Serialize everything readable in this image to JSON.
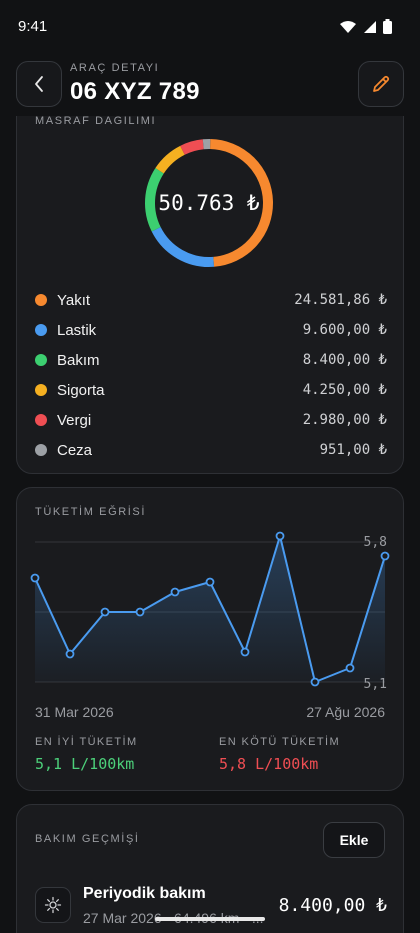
{
  "status_bar": {
    "time": "9:41"
  },
  "header": {
    "subtitle": "ARAÇ DETAYI",
    "title": "06 XYZ 789"
  },
  "expense": {
    "section_label": "MASRAF DAĞILIMI",
    "total": "50.763 ₺",
    "items": [
      {
        "name": "Yakıt",
        "value": "24.581,86 ₺",
        "amount": 24581.86,
        "color": "#f7892f"
      },
      {
        "name": "Lastik",
        "value": "9.600,00 ₺",
        "amount": 9600.0,
        "color": "#4a9bf0"
      },
      {
        "name": "Bakım",
        "value": "8.400,00 ₺",
        "amount": 8400.0,
        "color": "#3ccf70"
      },
      {
        "name": "Sigorta",
        "value": "4.250,00 ₺",
        "amount": 4250.0,
        "color": "#f5b021"
      },
      {
        "name": "Vergi",
        "value": "2.980,00 ₺",
        "amount": 2980.0,
        "color": "#ef4e53"
      },
      {
        "name": "Ceza",
        "value": "951,00 ₺",
        "amount": 951.0,
        "color": "#9da1a6"
      }
    ]
  },
  "consumption": {
    "section_label": "TÜKETİM EĞRİSİ",
    "date_start": "31 Mar 2026",
    "date_end": "27 Ağu 2026",
    "best_label": "EN İYİ TÜKETİM",
    "best_value": "5,1 L/100km",
    "worst_label": "EN KÖTÜ TÜKETİM",
    "worst_value": "5,8 L/100km"
  },
  "chart_data": {
    "type": "line",
    "y_tick_labels": [
      "5,8",
      "5,1"
    ],
    "ylim": [
      5.1,
      5.8
    ],
    "values": [
      5.62,
      5.24,
      5.45,
      5.45,
      5.55,
      5.6,
      5.25,
      5.83,
      5.1,
      5.17,
      5.73
    ],
    "x_start_label": "31 Mar 2026",
    "x_end_label": "27 Ağu 2026",
    "color": "#4a9bf0"
  },
  "maintenance": {
    "section_label": "BAKIM GEÇMİŞİ",
    "add_label": "Ekle",
    "items": [
      {
        "title": "Periyodik bakım",
        "meta": "27 Mar 2026 · 64.496 km · ...",
        "amount": "8.400,00 ₺",
        "icon": "gear-icon"
      }
    ]
  }
}
